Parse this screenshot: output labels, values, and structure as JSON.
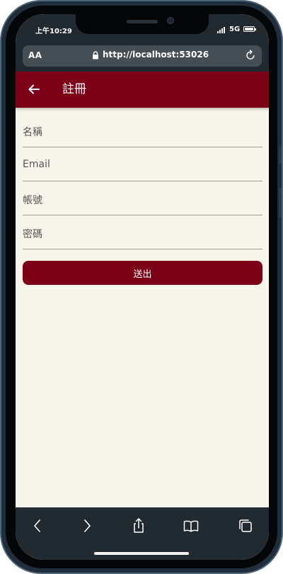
{
  "status_bar": {
    "time": "上午10:29",
    "network": "5G"
  },
  "browser": {
    "text_size_label": "AA",
    "url": "http://localhost:53026"
  },
  "header": {
    "title": "註冊"
  },
  "form": {
    "fields": [
      {
        "label": "名稱"
      },
      {
        "label": "Email"
      },
      {
        "label": "帳號"
      },
      {
        "label": "密碼"
      }
    ],
    "submit_label": "送出"
  },
  "toolbar": {
    "items": [
      "back-icon",
      "forward-icon",
      "share-icon",
      "bookmarks-icon",
      "tabs-icon"
    ]
  },
  "colors": {
    "accent": "#7d0019",
    "background": "#f8f5ea",
    "chrome": "#222a31"
  }
}
